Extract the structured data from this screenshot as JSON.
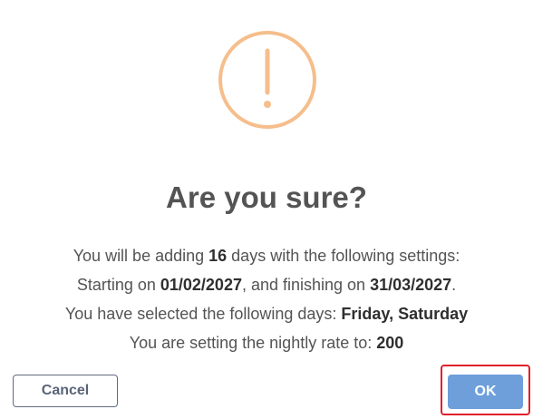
{
  "dialog": {
    "icon": "exclamation-circle-icon",
    "icon_color": "#f5be8c",
    "title": "Are you sure?",
    "line1": {
      "pre": "You will be adding ",
      "days": "16",
      "post": " days with the following settings:"
    },
    "line2": {
      "pre": "Starting on ",
      "start_date": "01/02/2027",
      "mid": ", and finishing on ",
      "end_date": "31/03/2027",
      "post": "."
    },
    "line3": {
      "pre": "You have selected the following days: ",
      "days": "Friday, Saturday"
    },
    "line4": {
      "pre": "You are setting the nightly rate to: ",
      "rate": "200"
    },
    "cancel_label": "Cancel",
    "ok_label": "OK",
    "ok_color": "#6e9fdb",
    "highlight_color": "#e0202a"
  }
}
